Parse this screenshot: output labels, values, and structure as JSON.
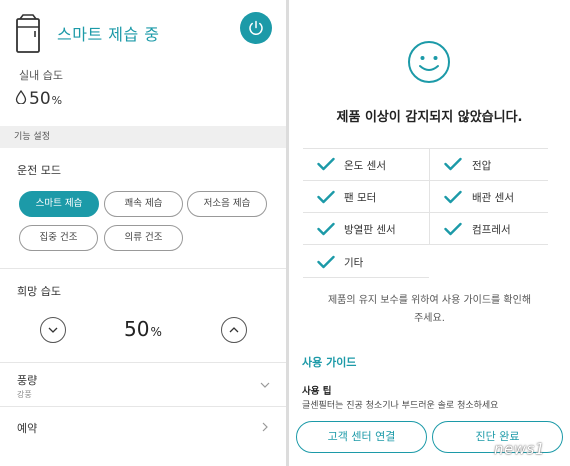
{
  "header": {
    "title": "스마트 제습 중",
    "indoor_humidity_label": "실내 습도",
    "indoor_humidity_value": "50",
    "indoor_humidity_unit": "%"
  },
  "section": {
    "label": "기능 설정"
  },
  "operation_mode": {
    "label": "운전 모드",
    "options": [
      "스마트 제습",
      "쾌속 제습",
      "저소음 제습",
      "집중 건조",
      "의류 건조"
    ],
    "selected": "스마트 제습"
  },
  "target_humidity": {
    "label": "희망 습도",
    "value": "50",
    "unit": "%"
  },
  "fan": {
    "label": "풍량",
    "value": "강풍"
  },
  "reservation": {
    "label": "예약"
  },
  "diagnosis": {
    "title": "제품 이상이 감지되지 않았습니다.",
    "items": [
      "온도 센서",
      "전압",
      "팬 모터",
      "배관 센서",
      "방열판 센서",
      "컴프레서",
      "기타"
    ],
    "note_line1": "제품의 유지 보수를 위하여 사용 가이드를 확인해",
    "note_line2": "주세요.",
    "guide_title": "사용 가이드",
    "tip_title": "사용 팁",
    "tip_text": "글센필터는 진공 청소기나 부드러운 솔로 청소하세요"
  },
  "buttons": {
    "customer_center": "고객 센터 연결",
    "complete": "진단 완료"
  },
  "watermark": "news1",
  "colors": {
    "accent": "#1c9aa8",
    "background": "#ffffff",
    "section_bar": "#efefef"
  },
  "icons": {
    "device": "dehumidifier-icon",
    "power": "power-icon",
    "smiley": "smiley-icon",
    "check": "check-icon"
  }
}
